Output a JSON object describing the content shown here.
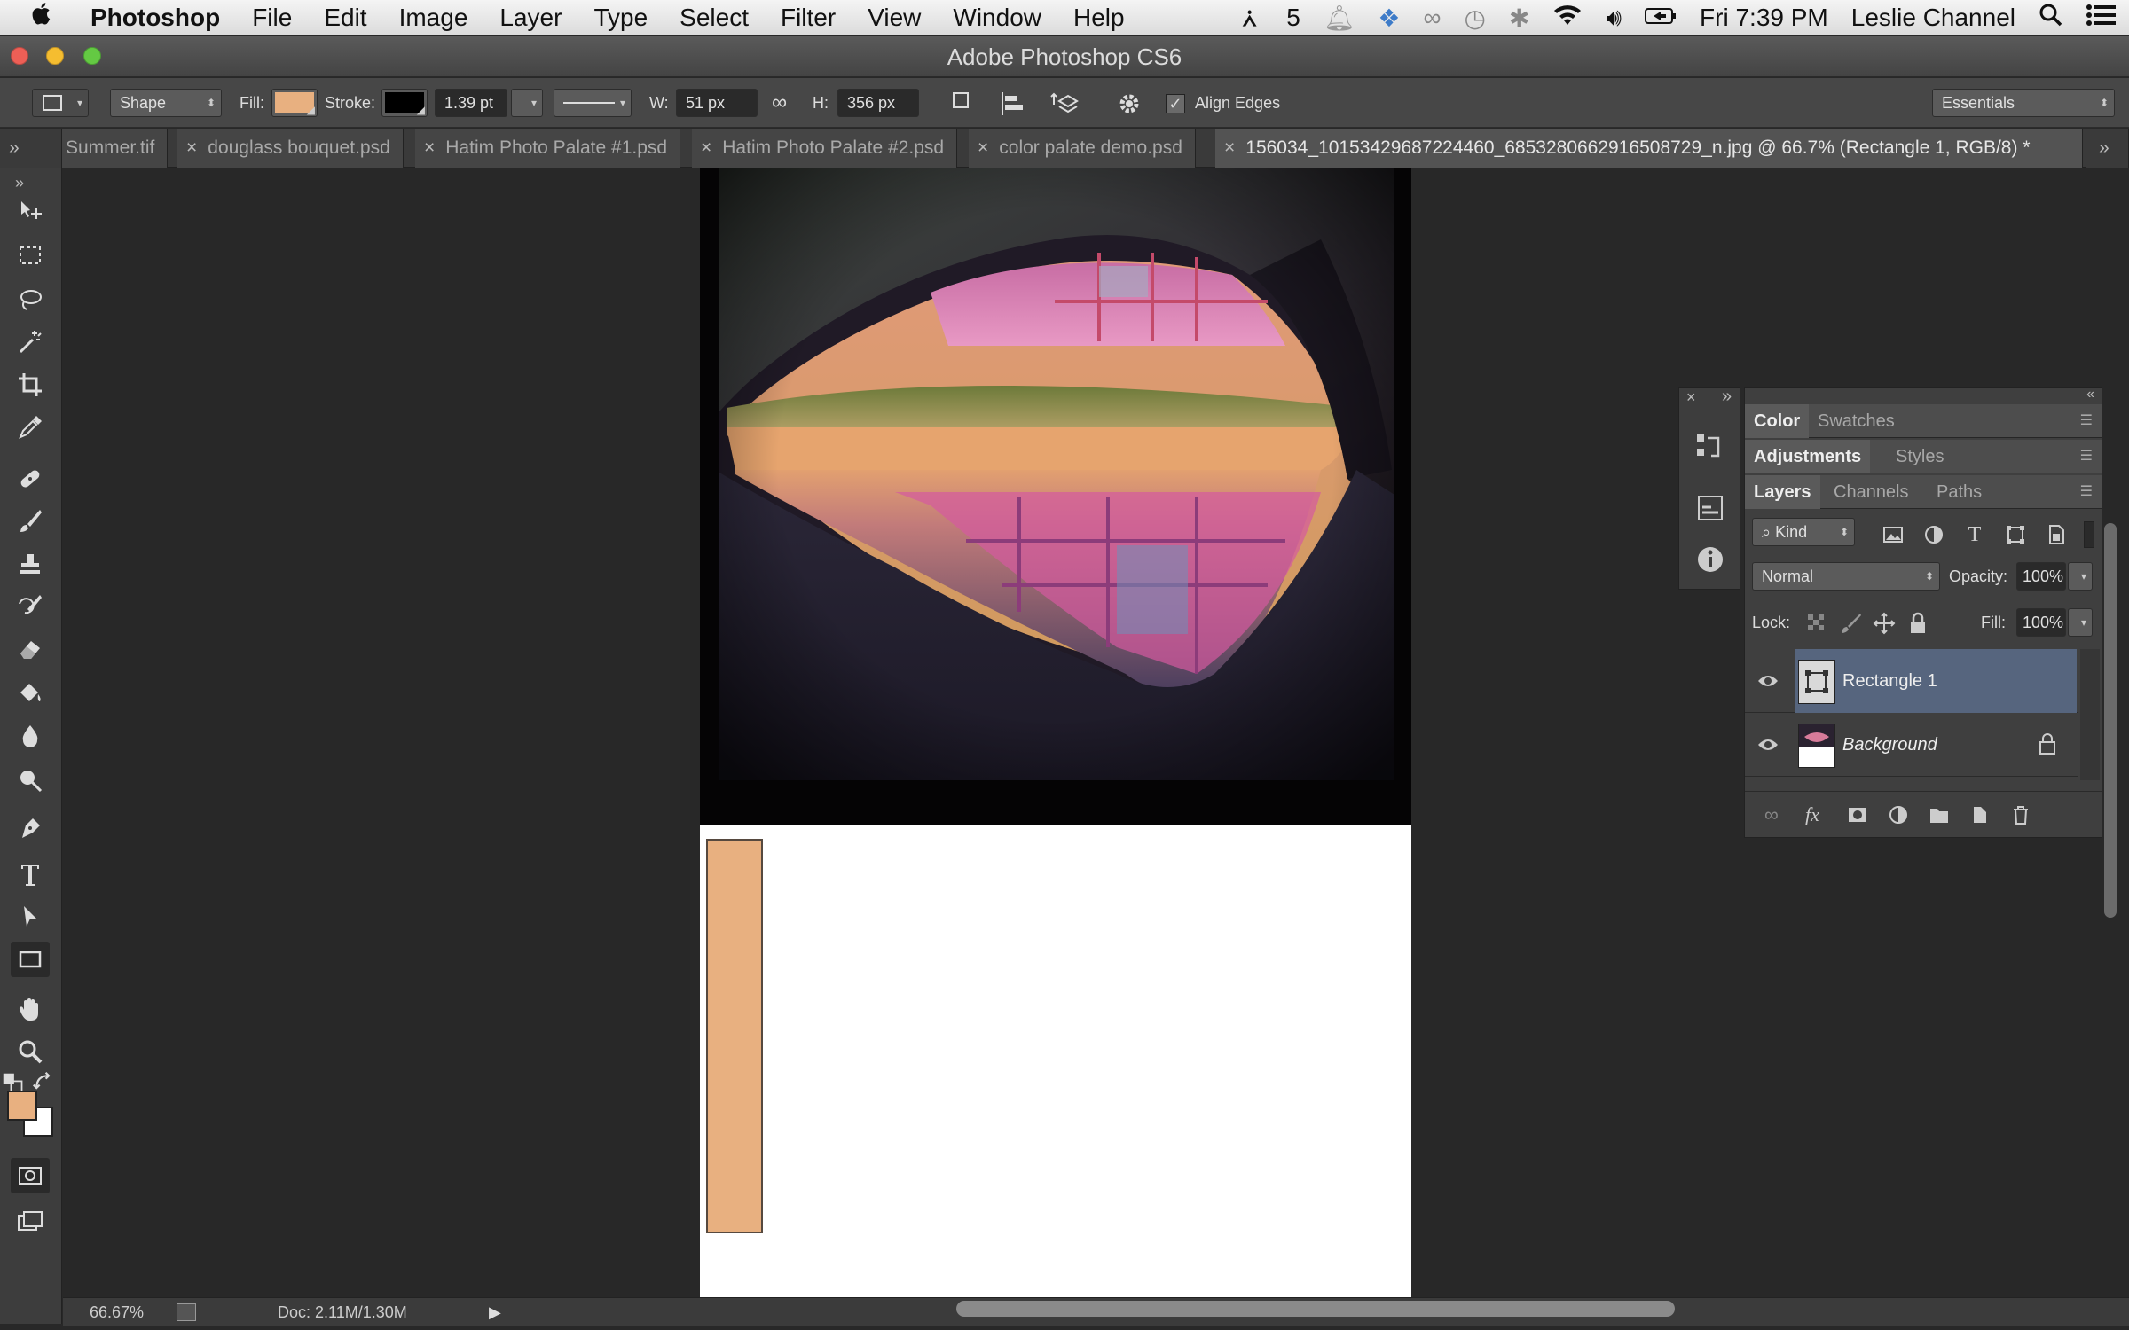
{
  "menubar": {
    "app": "Photoshop",
    "items": [
      "File",
      "Edit",
      "Image",
      "Layer",
      "Type",
      "Select",
      "Filter",
      "View",
      "Window",
      "Help"
    ],
    "adobe_count": "5",
    "clock": "Fri 7:39 PM",
    "user": "Leslie Channel"
  },
  "window": {
    "title": "Adobe Photoshop CS6"
  },
  "options": {
    "mode": "Shape",
    "fill_label": "Fill:",
    "fill_color": "#e8b080",
    "stroke_label": "Stroke:",
    "stroke_color": "#000000",
    "stroke_width": "1.39 pt",
    "w_label": "W:",
    "w_value": "51 px",
    "h_label": "H:",
    "h_value": "356 px",
    "align_edges": "Align Edges",
    "workspace": "Essentials"
  },
  "tabs": [
    {
      "label": "Summer.tif"
    },
    {
      "label": "douglass bouquet.psd"
    },
    {
      "label": "Hatim Photo Palate #1.psd"
    },
    {
      "label": "Hatim Photo Palate #2.psd"
    },
    {
      "label": "color palate demo.psd"
    },
    {
      "label": "156034_10153429687224460_6853280662916508729_n.jpg @ 66.7% (Rectangle 1, RGB/8) *"
    }
  ],
  "panels": {
    "group1": [
      "Color",
      "Swatches"
    ],
    "group2": [
      "Adjustments",
      "Styles"
    ],
    "group3": [
      "Layers",
      "Channels",
      "Paths"
    ],
    "filter_kind": "Kind",
    "blend_mode": "Normal",
    "opacity_label": "Opacity:",
    "opacity": "100%",
    "lock_label": "Lock:",
    "fill_label": "Fill:",
    "fill": "100%",
    "layers": [
      {
        "name": "Rectangle 1",
        "selected": true
      },
      {
        "name": "Background",
        "selected": false
      }
    ]
  },
  "status": {
    "zoom": "66.67%",
    "doc": "Doc: 2.11M/1.30M"
  },
  "colors": {
    "foreground": "#e8b080",
    "background": "#ffffff",
    "selection": "#56657e"
  }
}
